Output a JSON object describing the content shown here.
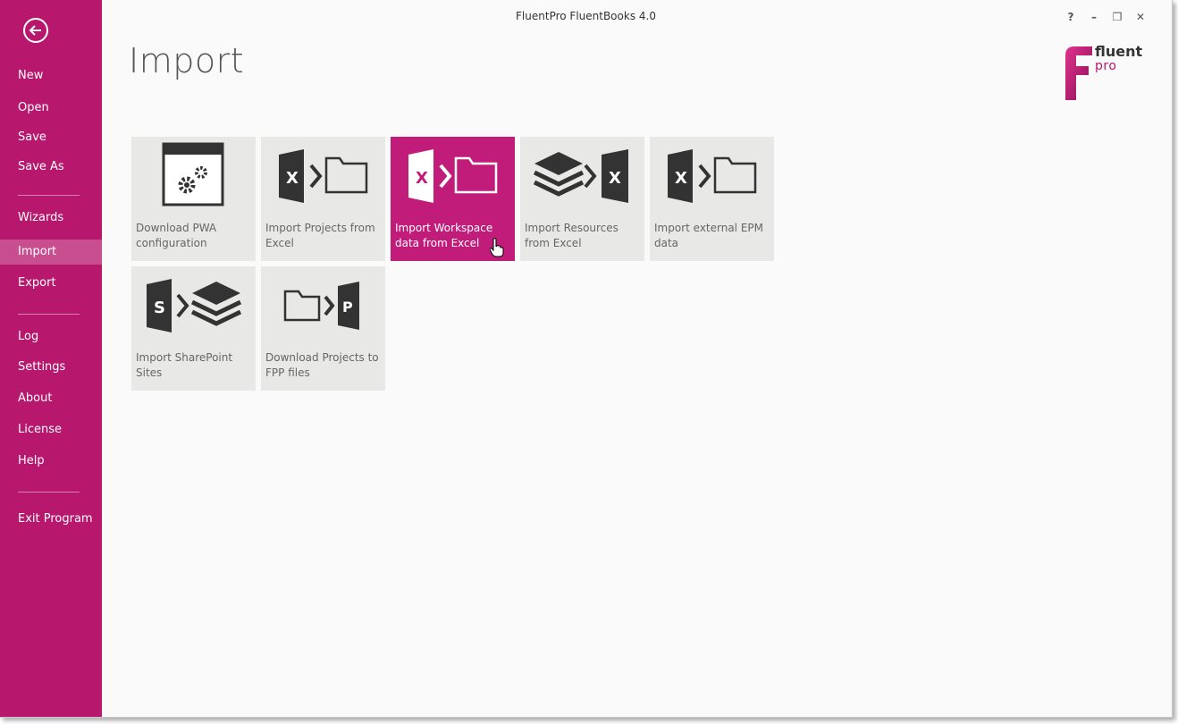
{
  "window": {
    "title": "FluentPro FluentBooks 4.0",
    "controls": [
      "?",
      "–",
      "❐",
      "✕"
    ]
  },
  "sidebar": {
    "back_icon": "arrow-left-circle-icon",
    "items": [
      {
        "label": "New"
      },
      {
        "label": "Open"
      },
      {
        "label": "Save"
      },
      {
        "label": "Save As"
      },
      {
        "label": "Wizards"
      },
      {
        "label": "Import",
        "active": true
      },
      {
        "label": "Export"
      },
      {
        "label": "Log"
      },
      {
        "label": "Settings"
      },
      {
        "label": "About"
      },
      {
        "label": "License"
      },
      {
        "label": "Help"
      },
      {
        "label": "Exit Program"
      }
    ]
  },
  "page": {
    "title": "Import"
  },
  "logo": {
    "line1": "fluent",
    "line2": "pro"
  },
  "tiles": [
    {
      "label": "Download PWA configuration",
      "icon": "pwa-settings-icon"
    },
    {
      "label": "Import Projects from Excel",
      "icon": "excel-to-folder-icon"
    },
    {
      "label": "Import Workspace data from Excel",
      "icon": "excel-to-folder-icon",
      "active": true
    },
    {
      "label": "Import Resources from Excel",
      "icon": "layers-to-excel-icon"
    },
    {
      "label": "Import external EPM data",
      "icon": "excel-to-folder-icon"
    },
    {
      "label": "Import SharePoint Sites",
      "icon": "sharepoint-to-layers-icon"
    },
    {
      "label": "Download Projects to FPP files",
      "icon": "folder-to-project-icon"
    }
  ],
  "colors": {
    "accent": "#b7186d",
    "tile_active": "#c11c7a",
    "tile_bg": "#e8e8e7",
    "icon": "#333333"
  }
}
